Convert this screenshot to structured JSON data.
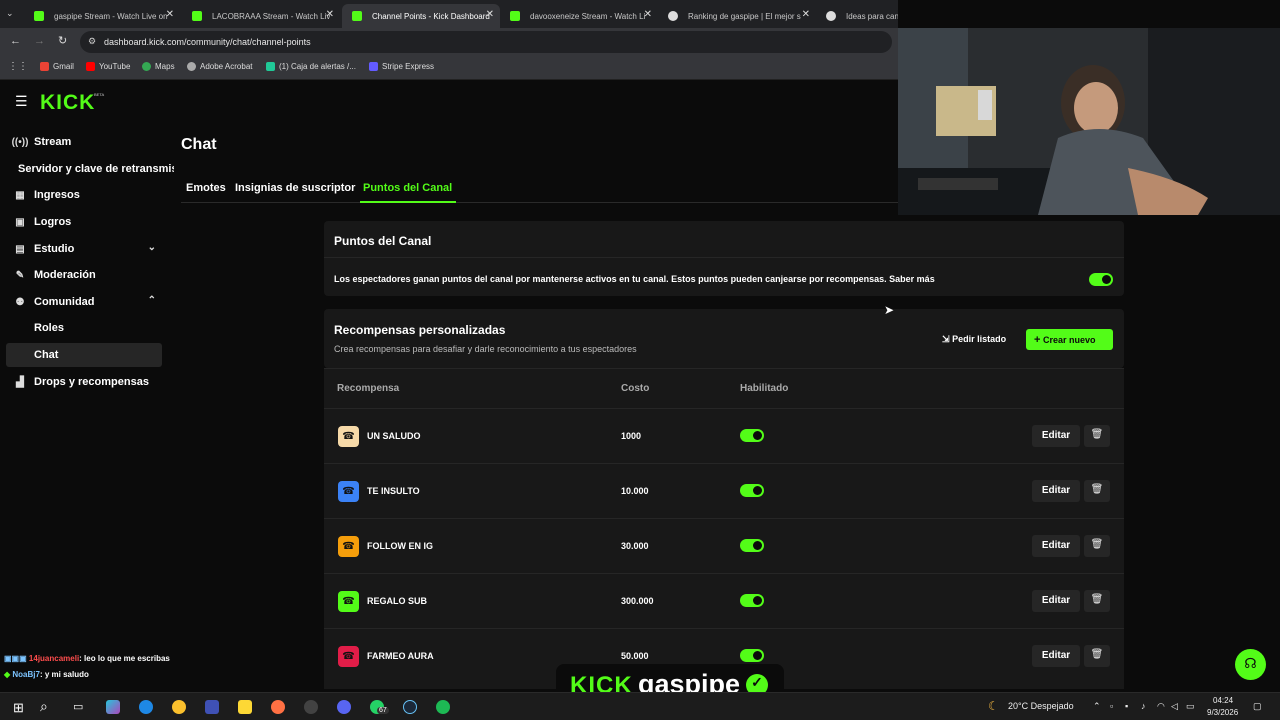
{
  "browser": {
    "tabs": [
      {
        "title": "gaspipe Stream - Watch Live on",
        "favicon": "#53fc18",
        "active": false
      },
      {
        "title": "LACOBRAAA Stream - Watch Live",
        "favicon": "#53fc18",
        "active": false
      },
      {
        "title": "Channel Points - Kick Dashboard",
        "favicon": "#53fc18",
        "active": true
      },
      {
        "title": "davooxeneize Stream - Watch Li",
        "favicon": "#53fc18",
        "active": false
      },
      {
        "title": "Ranking de gaspipe | El mejor s",
        "favicon": "#ddd",
        "active": false
      },
      {
        "title": "Ideas para canje",
        "favicon": "#ddd",
        "active": false
      }
    ],
    "url": "dashboard.kick.com/community/chat/channel-points",
    "bookmarks": [
      {
        "label": "Gmail",
        "color": "#ea4335"
      },
      {
        "label": "YouTube",
        "color": "#ff0000"
      },
      {
        "label": "Maps",
        "color": "#34a853"
      },
      {
        "label": "Adobe Acrobat",
        "color": "#aaaaaa"
      },
      {
        "label": "(1) Caja de alertas /...",
        "color": "#20c997"
      },
      {
        "label": "Stripe Express",
        "color": "#635bff"
      }
    ]
  },
  "sidebar": {
    "logo": "KICK",
    "beta": "BETA",
    "items": [
      {
        "label": "Stream",
        "icon": "broadcast-icon",
        "glyph": "((•))"
      },
      {
        "label": "Servidor y clave de retransmisión",
        "icon": "",
        "glyph": ""
      },
      {
        "label": "Ingresos",
        "icon": "revenue-icon",
        "glyph": "▦"
      },
      {
        "label": "Logros",
        "icon": "trophy-icon",
        "glyph": "▣"
      },
      {
        "label": "Estudio",
        "icon": "studio-icon",
        "glyph": "▤"
      },
      {
        "label": "Moderación",
        "icon": "wrench-icon",
        "glyph": "✎"
      },
      {
        "label": "Comunidad",
        "icon": "people-icon",
        "glyph": "👥"
      },
      {
        "label": "Roles",
        "icon": "",
        "glyph": ""
      },
      {
        "label": "Chat",
        "icon": "",
        "glyph": ""
      },
      {
        "label": "Drops y recompensas",
        "icon": "drops-icon",
        "glyph": "▟"
      }
    ]
  },
  "main": {
    "title": "Chat",
    "tabs": [
      "Emotes",
      "Insignias de suscriptor",
      "Puntos del Canal"
    ],
    "points_card": {
      "title": "Puntos del Canal",
      "description": "Los espectadores ganan puntos del canal por mantenerse activos en tu canal. Estos puntos pueden canjearse por recompensas. Saber más",
      "enabled": true
    },
    "rewards": {
      "title": "Recompensas personalizadas",
      "subtitle": "Crea recompensas para desafiar y darle reconocimiento a tus espectadores",
      "request_label": "Pedir listado",
      "create_label": "Crear nuevo",
      "columns": [
        "Recompensa",
        "Costo",
        "Habilitado"
      ],
      "edit_label": "Editar",
      "rows": [
        {
          "name": "UN SALUDO",
          "cost": "1000",
          "color": "#f6d9a8",
          "enabled": true
        },
        {
          "name": "TE INSULTO",
          "cost": "10.000",
          "color": "#3b82f6",
          "enabled": true
        },
        {
          "name": "FOLLOW EN IG",
          "cost": "30.000",
          "color": "#f59e0b",
          "enabled": true
        },
        {
          "name": "REGALO SUB",
          "cost": "300.000",
          "color": "#53fc18",
          "enabled": true
        },
        {
          "name": "FARMEO AURA",
          "cost": "50.000",
          "color": "#e11d48",
          "enabled": true
        }
      ]
    }
  },
  "chat_overlay": [
    {
      "user": "14juancameli",
      "message": ": leo lo que me escribas",
      "color": "#ff4d4d"
    },
    {
      "user": "NoaBj7",
      "message": ": y mi saludo",
      "color": "#7cc4ff"
    }
  ],
  "overlay_brand": {
    "prefix": "KICK",
    "name": "gaspipe"
  },
  "taskbar": {
    "weather": "20°C  Despejado",
    "time": "04:24",
    "date": "9/3/2026",
    "badge": "67"
  }
}
